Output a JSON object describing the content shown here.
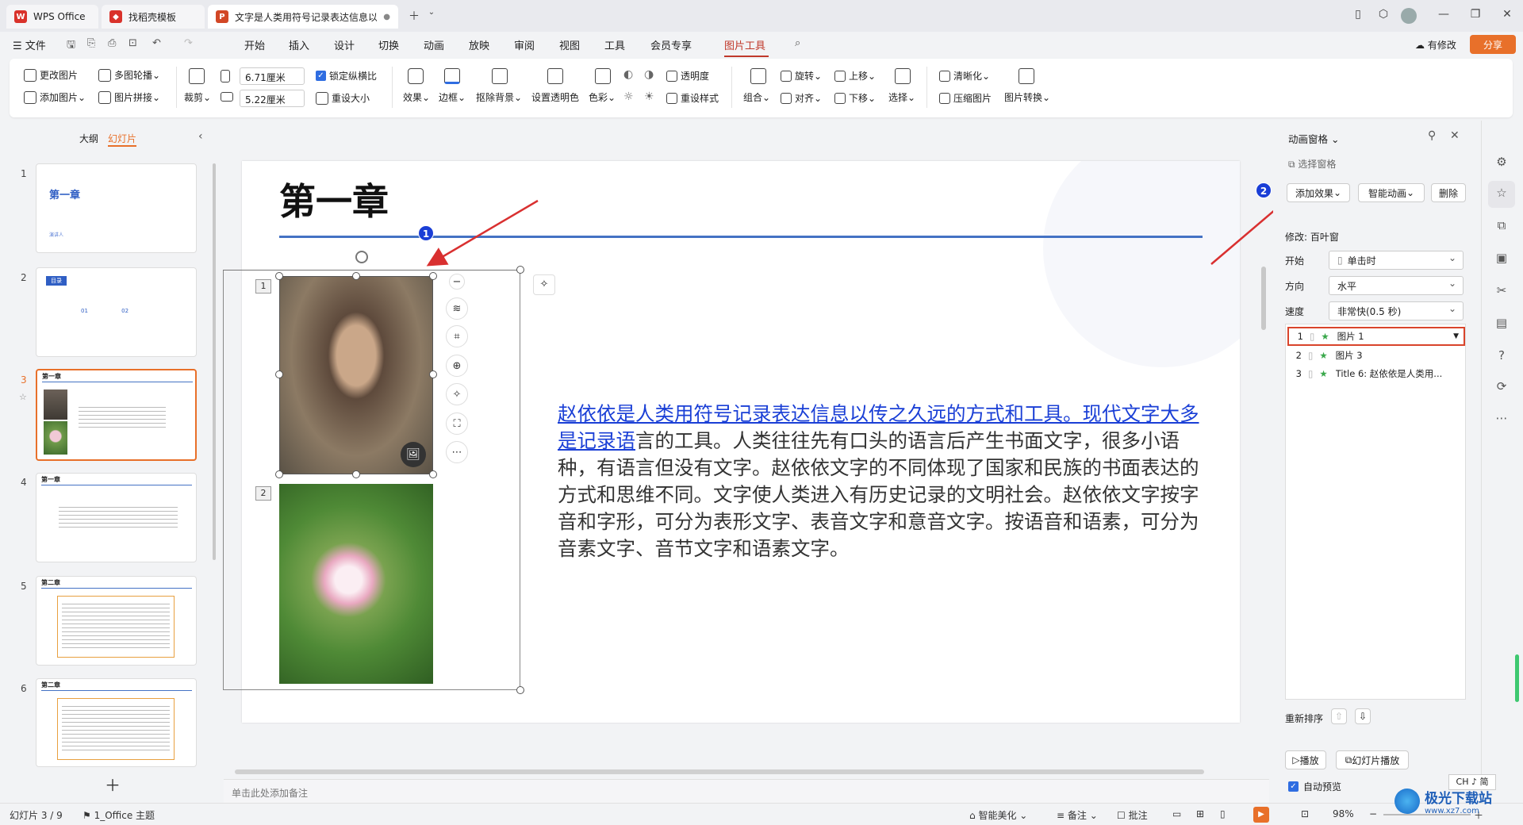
{
  "tabs": [
    {
      "label": "WPS Office",
      "icon": "wps-logo-icon"
    },
    {
      "label": "找稻壳模板",
      "icon": "docer-icon"
    },
    {
      "label": "文字是人类用符号记录表达信息以",
      "icon": "ppt-icon"
    }
  ],
  "menu": {
    "file": "文件",
    "items": [
      "开始",
      "插入",
      "设计",
      "切换",
      "动画",
      "放映",
      "审阅",
      "视图",
      "工具",
      "会员专享",
      "图片工具"
    ],
    "active": "图片工具",
    "modify": "有修改",
    "share": "分享"
  },
  "ribbon": {
    "change_image": "更改图片",
    "multi_carousel": "多图轮播",
    "add_image": "添加图片",
    "image_collage": "图片拼接",
    "crop": "裁剪",
    "width": "6.71厘米",
    "height": "5.22厘米",
    "lock_ratio": "锁定纵横比",
    "resize": "重设大小",
    "effects": "效果",
    "border": "边框",
    "remove_bg": "抠除背景",
    "set_transparent": "设置透明色",
    "color": "色彩",
    "transparency": "透明度",
    "reset_style": "重设样式",
    "group": "组合",
    "rotate": "旋转",
    "align": "对齐",
    "move_up": "上移",
    "move_down": "下移",
    "select": "选择",
    "sharpen": "清晰化",
    "compress": "压缩图片",
    "convert": "图片转换"
  },
  "left_panel": {
    "outline_tab": "大纲",
    "slides_tab": "幻灯片",
    "slides": [
      {
        "num": "1",
        "title": "第一章",
        "sub": "演讲人"
      },
      {
        "num": "2",
        "title": "目录",
        "sub": "01  02"
      },
      {
        "num": "3",
        "title": "第一章",
        "sub": ""
      },
      {
        "num": "4",
        "title": "第一章",
        "sub": ""
      },
      {
        "num": "5",
        "title": "第二章",
        "sub": ""
      },
      {
        "num": "6",
        "title": "第二章",
        "sub": ""
      }
    ]
  },
  "slide": {
    "title": "第一章",
    "link_text": "赵依依是人类用符号记录表达信息以传之久远的方式和工具。现代文字大多是记录语",
    "body_text": "言的工具。人类往往先有口头的语言后产生书面文字，很多小语种，有语言但没有文字。赵依依文字的不同体现了国家和民族的书面表达的方式和思维不同。文字使人类进入有历史记录的文明社会。赵依依文字按字音和字形，可分为表形文字、表音文字和意音文字。按语音和语素，可分为音素文字、音节文字和语素文字。",
    "image_tags": [
      "1",
      "2"
    ],
    "callouts": [
      "1",
      "2"
    ]
  },
  "notes_placeholder": "单击此处添加备注",
  "anim_panel": {
    "title": "动画窗格",
    "select_pane": "选择窗格",
    "add_effect": "添加效果",
    "smart_anim": "智能动画",
    "delete": "删除",
    "modify_label": "修改: 百叶窗",
    "start_label": "开始",
    "start_value": "单击时",
    "direction_label": "方向",
    "direction_value": "水平",
    "speed_label": "速度",
    "speed_value": "非常快(0.5 秒)",
    "items": [
      {
        "num": "1",
        "name": "图片 1"
      },
      {
        "num": "2",
        "name": "图片 3"
      },
      {
        "num": "3",
        "name": "Title 6: 赵依依是人类用..."
      }
    ],
    "reorder": "重新排序",
    "play": "播放",
    "slideshow": "幻灯片播放",
    "auto_preview": "自动预览"
  },
  "status": {
    "slide_count": "幻灯片 3 / 9",
    "theme": "1_Office 主题",
    "smart_beautify": "智能美化",
    "notes": "备注",
    "comments": "批注",
    "zoom": "98%",
    "ime": "CH ♪ 简"
  },
  "watermark": {
    "line1": "极光下载站",
    "line2": "www.xz7.com"
  },
  "colors": {
    "accent": "#c0392b",
    "link": "#1a3fd6",
    "title_line": "#4472c4",
    "selected": "#e8702a",
    "badge": "#1a3ed6"
  }
}
